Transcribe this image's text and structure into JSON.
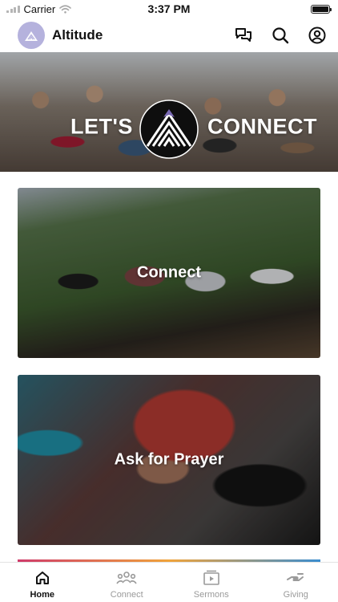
{
  "status_bar": {
    "carrier": "Carrier",
    "time": "3:37 PM"
  },
  "header": {
    "app_name": "Altitude",
    "icons": [
      "altitude-logo",
      "chat-icon",
      "search-icon",
      "profile-icon"
    ]
  },
  "hero": {
    "text_left": "LET'S",
    "text_right": "CONNECT"
  },
  "feed": [
    {
      "title": "Connect"
    },
    {
      "title": "Ask for Prayer"
    }
  ],
  "tabs": [
    {
      "label": "Home",
      "icon": "home-icon",
      "active": true
    },
    {
      "label": "Connect",
      "icon": "people-icon",
      "active": false
    },
    {
      "label": "Sermons",
      "icon": "video-icon",
      "active": false
    },
    {
      "label": "Giving",
      "icon": "giving-icon",
      "active": false
    }
  ],
  "colors": {
    "accent": "#b5b2dd",
    "tab_active": "#111111",
    "tab_inactive": "#9a9a9a"
  }
}
